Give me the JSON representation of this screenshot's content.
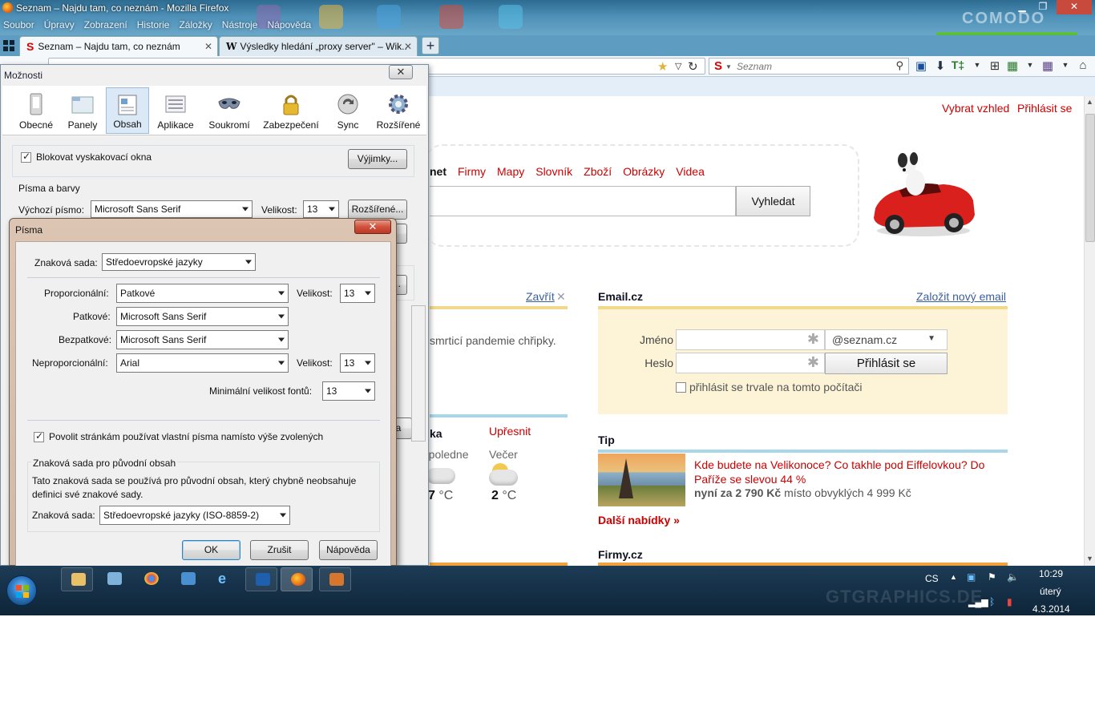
{
  "window": {
    "title": "Seznam – Najdu tam, co neznám - Mozilla Firefox",
    "menu": [
      "Soubor",
      "Úpravy",
      "Zobrazení",
      "Historie",
      "Záložky",
      "Nástroje",
      "Nápověda"
    ]
  },
  "tabs": [
    {
      "label": "Seznam – Najdu tam, co neznám",
      "active": true
    },
    {
      "label": "Výsledky hledání „proxy server\" – Wik...",
      "active": false
    }
  ],
  "navbar": {
    "search_placeholder": "Seznam"
  },
  "page": {
    "top_links": {
      "vzhled": "Vybrat vzhled",
      "login": "Přihlásit se"
    },
    "search_tabs": [
      "net",
      "Firmy",
      "Mapy",
      "Slovník",
      "Zboží",
      "Obrázky",
      "Videa"
    ],
    "search_button": "Vyhledat",
    "news_close": "Zavřít",
    "news_snippet": "smrticí pandemie chřipky.",
    "email": {
      "title": "Email.cz",
      "create_link": "Založit nový email",
      "name_label": "Jméno",
      "password_label": "Heslo",
      "domain": "@seznam.cz",
      "login_button": "Přihlásit se",
      "remember_label": "přihlásit se trvale na tomto počítači"
    },
    "weather": {
      "title_partial": "ka",
      "refine": "Upřesnit",
      "periods": [
        {
          "label": "Odpoledne",
          "temp": "7",
          "unit": "°C"
        },
        {
          "label": "Večer",
          "temp": "2",
          "unit": "°C"
        }
      ],
      "partial_label": "e"
    },
    "tip": {
      "title": "Tip",
      "headline": "Kde budete na Velikonoce? Co takhle pod Eiffelovkou? Do Paříže se slevou 44 %",
      "price_bold": "nyní za 2 790 Kč",
      "price_rest": "místo obvyklých 4 999 Kč",
      "more": "Další nabídky »"
    },
    "firmy_title": "Firmy.cz"
  },
  "options_dialog": {
    "title": "Možnosti",
    "panes": [
      "Obecné",
      "Panely",
      "Obsah",
      "Aplikace",
      "Soukromí",
      "Zabezpečení",
      "Sync",
      "Rozšířené"
    ],
    "active_pane": "Obsah",
    "popup_block_label": "Blokovat vyskakovací okna",
    "exceptions_button": "Výjimky...",
    "fonts_group": "Písma a barvy",
    "default_font_label": "Výchozí písmo:",
    "default_font_value": "Microsoft Sans Serif",
    "size_label": "Velikost:",
    "size_value": "13",
    "advanced_button": "Rozšířené...",
    "hidden_button_partial": "la"
  },
  "fonts_dialog": {
    "title": "Písma",
    "charset_label": "Znaková sada:",
    "charset_value": "Středoevropské jazyky",
    "proportional_label": "Proporcionální:",
    "proportional_value": "Patkové",
    "size_label": "Velikost:",
    "proportional_size": "13",
    "serif_label": "Patkové:",
    "serif_value": "Microsoft Sans Serif",
    "sans_label": "Bezpatkové:",
    "sans_value": "Microsoft Sans Serif",
    "mono_label": "Neproporcionální:",
    "mono_value": "Arial",
    "mono_size": "13",
    "min_size_label": "Minimální velikost fontů:",
    "min_size_value": "13",
    "allow_fonts_label": "Povolit stránkám používat vlastní písma namísto výše zvolených",
    "legacy_group": "Znaková sada pro původní obsah",
    "legacy_desc": "Tato znaková sada se používá pro původní obsah, který chybně neobsahuje definici své znakové sady.",
    "legacy_charset_label": "Znaková sada:",
    "legacy_charset_value": "Středoevropské jazyky (ISO-8859-2)",
    "ok": "OK",
    "cancel": "Zrušit",
    "help": "Nápověda"
  },
  "taskbar": {
    "lang": "CS",
    "time": "10:29",
    "day": "úterý",
    "date": "4.3.2014",
    "watermark": "GTGRAPHICS.DE"
  },
  "colors": {
    "seznam_red": "#cc0000",
    "win_title": "#4d8fb6",
    "taskbar": "#16324a"
  }
}
